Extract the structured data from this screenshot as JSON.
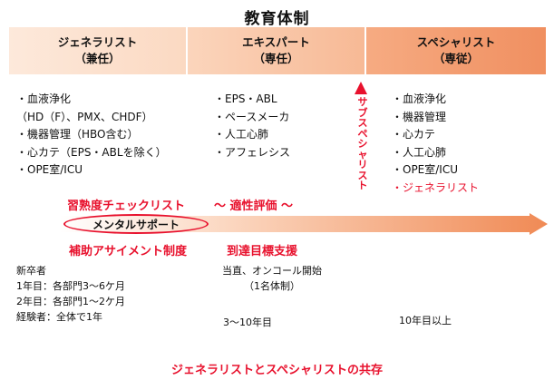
{
  "title": "教育体制",
  "tracks": [
    {
      "name": "ジェネラリスト",
      "role": "（兼任）"
    },
    {
      "name": "エキスパート",
      "role": "（専任）"
    },
    {
      "name": "スペシャリスト",
      "role": "（専従）"
    }
  ],
  "generalist_items": [
    "・血液浄化",
    "（HD（F）、PMX、CHDF）",
    "・機器管理（HBO含む）",
    "・心カテ（EPS・ABLを除く）",
    "・OPE室/ICU"
  ],
  "expert_items": [
    "・EPS・ABL",
    "・ペースメーカ",
    "・人工心肺",
    "・アフェレシス"
  ],
  "specialist_items": [
    "・血液浄化",
    "・機器管理",
    "・心カテ",
    "・人工心肺",
    "・OPE室/ICU"
  ],
  "specialist_extra": "・ジェネラリスト",
  "subspecialist_label": [
    "サ",
    "ブ",
    "ス",
    "ペ",
    "シ",
    "ャ",
    "リ",
    "ス",
    "ト"
  ],
  "checklist_label": "習熟度チェックリスト",
  "aptitude_label": "～ 適性評価 ～",
  "mental_support": "メンタルサポート",
  "assessment_label": "補助アサイメント制度",
  "goal_support": "到達目標支援",
  "newgrad": {
    "heading": "新卒者",
    "lines": [
      "1年目：各部門3～6ケ月",
      "2年目：各部門1～2ケ月",
      "経験者：全体で1年"
    ]
  },
  "oncall": {
    "line1": "当直、オンコール開始",
    "line2": "（1名体制）"
  },
  "years_mid": "3～10年目",
  "years_late": "10年目以上",
  "footer": "ジェネラリストとスペシャリストの共存",
  "colors": {
    "accent": "#e8112d",
    "arrow_start": "#ffffff",
    "arrow_end": "#f08a55"
  }
}
